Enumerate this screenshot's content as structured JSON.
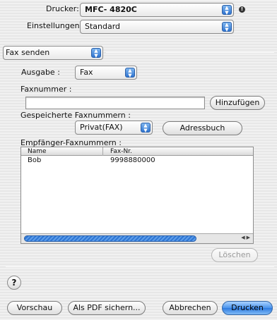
{
  "printer": {
    "label": "Drucker:",
    "value": "MFC- 4820C"
  },
  "settings": {
    "label": "Einstellungen:",
    "value": "Standard"
  },
  "panel_select": {
    "value": "Fax senden"
  },
  "output": {
    "label": "Ausgabe :",
    "value": "Fax"
  },
  "fax_number": {
    "label": "Faxnummer :",
    "value": "",
    "add_button": "Hinzufügen"
  },
  "stored": {
    "label": "Gespeicherte Faxnummern :",
    "value": "Privat(FAX)",
    "address_book_button": "Adressbuch"
  },
  "recipients": {
    "label": "Empfänger-Faxnummern :",
    "columns": [
      "Name",
      "Fax-Nr."
    ],
    "rows": [
      {
        "name": "Bob",
        "fax": "9998880000"
      }
    ],
    "delete_button": "Löschen"
  },
  "footer": {
    "preview_button": "Vorschau",
    "save_pdf_button": "Als PDF sichern...",
    "cancel_button": "Abbrechen",
    "print_button": "Drucken"
  },
  "icons": {
    "popup_arrows": "popup-arrows-icon",
    "info": "info-icon",
    "help": "help-icon"
  }
}
